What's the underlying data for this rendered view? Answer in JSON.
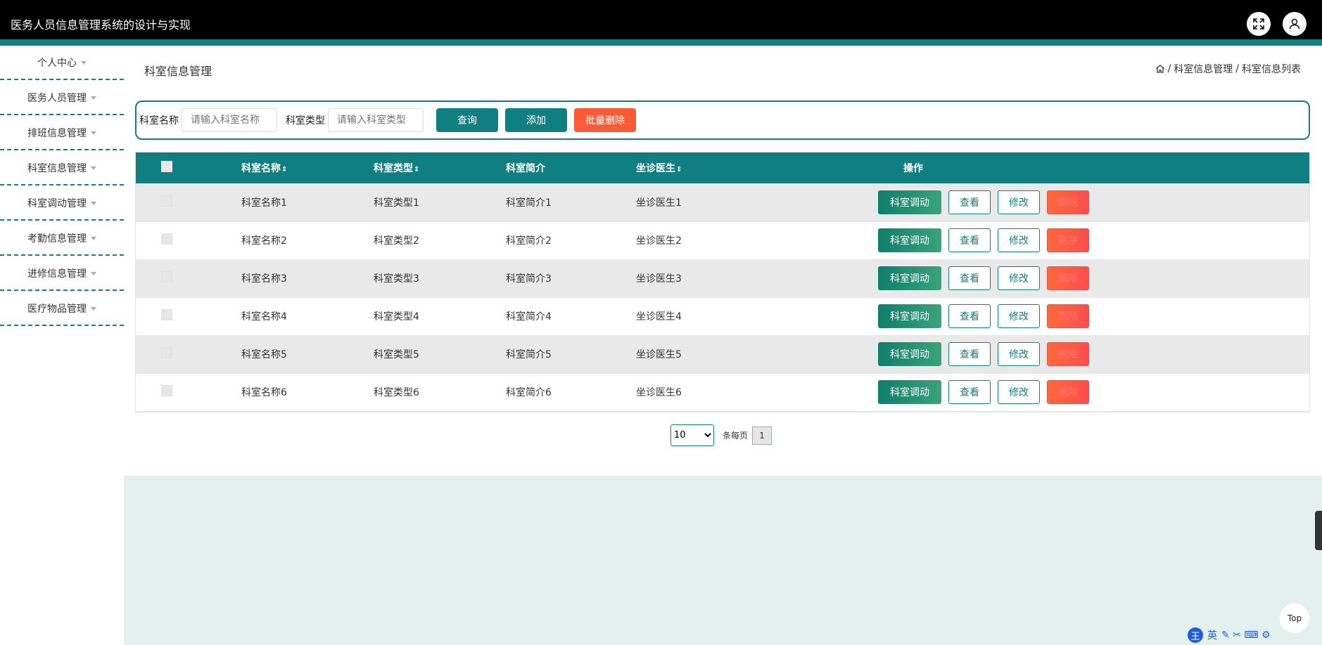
{
  "header": {
    "title": "医务人员信息管理系统的设计与实现"
  },
  "icons": {
    "fullscreen": "fullscreen-icon",
    "user": "user-icon",
    "home": "home-icon"
  },
  "sidebar": {
    "items": [
      {
        "label": "个人中心"
      },
      {
        "label": "医务人员管理"
      },
      {
        "label": "排班信息管理"
      },
      {
        "label": "科室信息管理"
      },
      {
        "label": "科室调动管理"
      },
      {
        "label": "考勤信息管理"
      },
      {
        "label": "进修信息管理"
      },
      {
        "label": "医疗物品管理"
      }
    ]
  },
  "page": {
    "title": "科室信息管理",
    "breadcrumb": [
      "科室信息管理",
      "科室信息列表"
    ],
    "breadcrumb_sep": "/"
  },
  "search": {
    "name_label": "科室名称",
    "name_placeholder": "请输入科室名称",
    "type_label": "科室类型",
    "type_placeholder": "请输入科室类型",
    "query_label": "查询",
    "add_label": "添加",
    "batch_delete_label": "批量删除"
  },
  "table": {
    "columns": [
      "科室名称",
      "科室类型",
      "科室简介",
      "坐诊医生",
      "操作"
    ],
    "sort_glyph": "⇕",
    "rows": [
      [
        "科室名称1",
        "科室类型1",
        "科室简介1",
        "坐诊医生1"
      ],
      [
        "科室名称2",
        "科室类型2",
        "科室简介2",
        "坐诊医生2"
      ],
      [
        "科室名称3",
        "科室类型3",
        "科室简介3",
        "坐诊医生3"
      ],
      [
        "科室名称4",
        "科室类型4",
        "科室简介4",
        "坐诊医生4"
      ],
      [
        "科室名称5",
        "科室类型5",
        "科室简介5",
        "坐诊医生5"
      ],
      [
        "科室名称6",
        "科室类型6",
        "科室简介6",
        "坐诊医生6"
      ]
    ],
    "actions": {
      "transfer": "科室调动",
      "view": "查看",
      "edit": "修改",
      "delete": "删除"
    }
  },
  "pagination": {
    "page_size": "10",
    "page_size_options": [
      "10"
    ],
    "per_page_label": "条每页",
    "current_page": "1"
  },
  "footer": {
    "top_label": "Top",
    "ime_label": "英"
  },
  "colors": {
    "primary": "#0f7f82",
    "danger": "#ff5a36",
    "bottom_bg": "#e3f0ed"
  }
}
